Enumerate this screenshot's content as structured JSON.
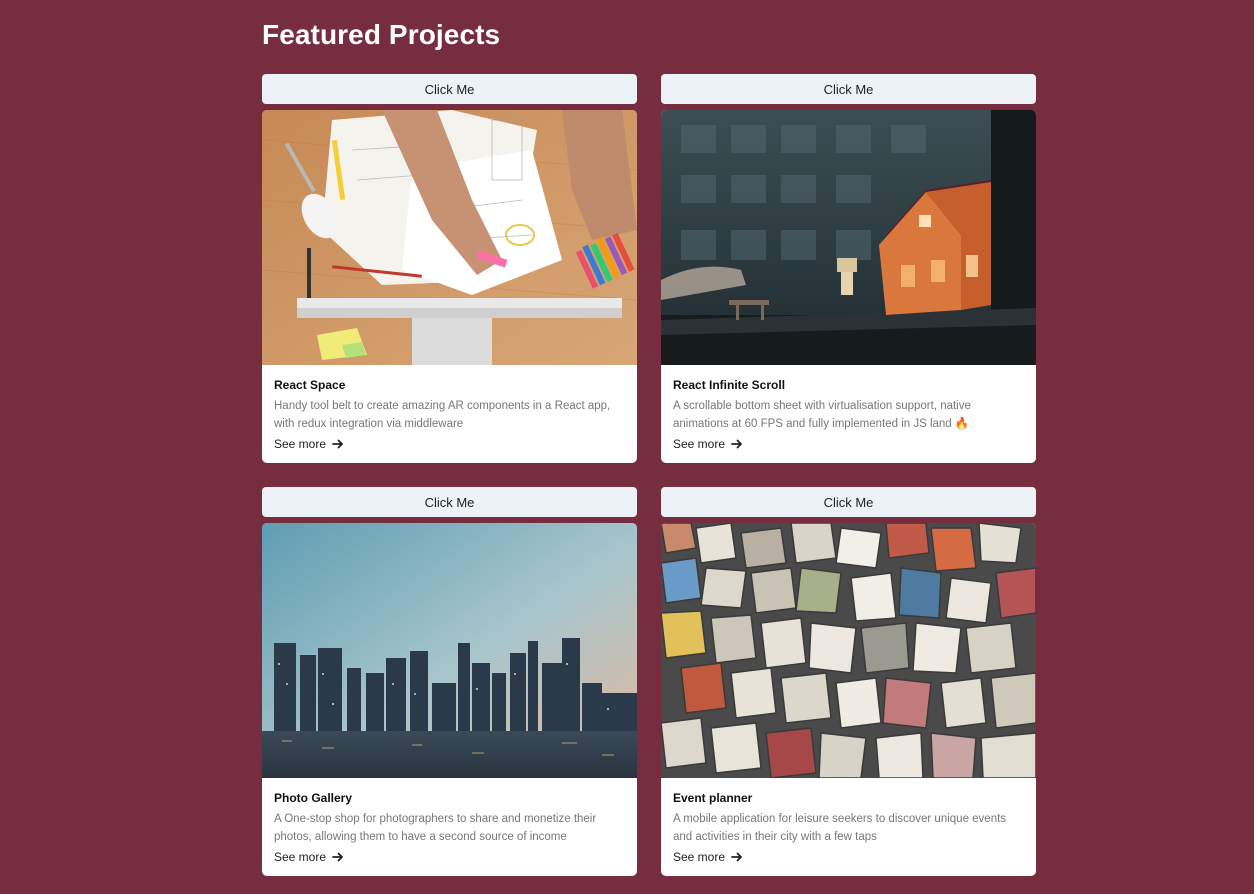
{
  "page": {
    "title": "Featured Projects"
  },
  "projects": [
    {
      "button_label": "Click Me",
      "title": "React Space",
      "description": "Handy tool belt to create amazing AR components in a React app, with redux integration via middleware",
      "link_label": "See more",
      "image_name": "desk-workspace-photo"
    },
    {
      "button_label": "Click Me",
      "title": "React Infinite Scroll",
      "description": "A scrollable bottom sheet with virtualisation support, native animations at 60 FPS and fully implemented in JS land 🔥",
      "link_label": "See more",
      "image_name": "dollhouse-photo"
    },
    {
      "button_label": "Click Me",
      "title": "Photo Gallery",
      "description": "A One-stop shop for photographers to share and monetize their photos, allowing them to have a second source of income",
      "link_label": "See more",
      "image_name": "city-skyline-photo"
    },
    {
      "button_label": "Click Me",
      "title": "Event planner",
      "description": "A mobile application for leisure seekers to discover unique events and activities in their city with a few taps",
      "link_label": "See more",
      "image_name": "colored-stones-photo"
    }
  ],
  "colors": {
    "background": "#772d40",
    "button_bg": "#edf2f7",
    "card_bg": "#ffffff"
  }
}
